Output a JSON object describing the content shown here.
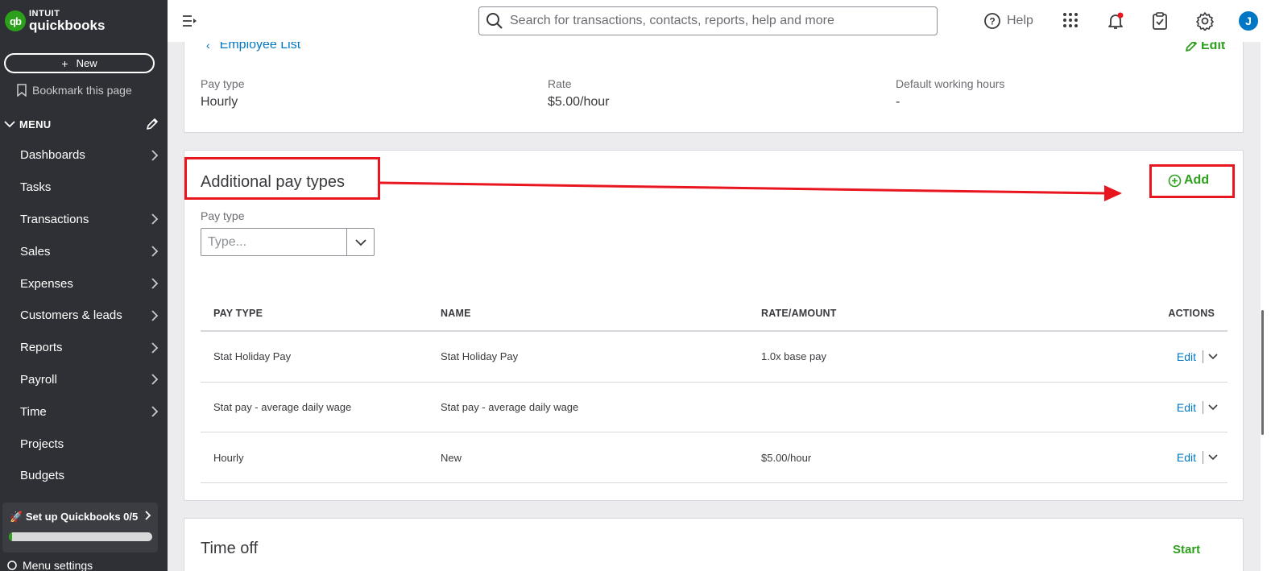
{
  "brand": {
    "line1": "INTUIT",
    "line2": "quickbooks",
    "mark": "qb"
  },
  "sidebar": {
    "new_label": "New",
    "bookmark_label": "Bookmark this page",
    "menu_label": "MENU",
    "items": [
      {
        "label": "Dashboards",
        "has_arrow": true
      },
      {
        "label": "Tasks",
        "has_arrow": false
      },
      {
        "label": "Transactions",
        "has_arrow": true
      },
      {
        "label": "Sales",
        "has_arrow": true
      },
      {
        "label": "Expenses",
        "has_arrow": true
      },
      {
        "label": "Customers & leads",
        "has_arrow": true
      },
      {
        "label": "Reports",
        "has_arrow": true
      },
      {
        "label": "Payroll",
        "has_arrow": true
      },
      {
        "label": "Time",
        "has_arrow": true
      },
      {
        "label": "Projects",
        "has_arrow": false
      },
      {
        "label": "Budgets",
        "has_arrow": false
      }
    ],
    "setup": {
      "label": "Set up Quickbooks 0/5",
      "progress": 0.02
    },
    "menu_settings_label": "Menu settings"
  },
  "topbar": {
    "search_placeholder": "Search for transactions, contacts, reports, help and more",
    "help_label": "Help",
    "avatar_initial": "J"
  },
  "employee": {
    "back_label": "Employee List",
    "edit_label": "Edit",
    "fields": [
      {
        "label": "Pay type",
        "value": "Hourly"
      },
      {
        "label": "Rate",
        "value": "$5.00/hour"
      },
      {
        "label": "Default working hours",
        "value": "-"
      }
    ]
  },
  "additional_pay": {
    "title": "Additional pay types",
    "add_label": "Add",
    "filter_label": "Pay type",
    "filter_placeholder": "Type...",
    "columns": [
      "PAY TYPE",
      "NAME",
      "RATE/AMOUNT",
      "ACTIONS"
    ],
    "rows": [
      {
        "pay_type": "Stat Holiday Pay",
        "name": "Stat Holiday Pay",
        "rate": "1.0x base pay",
        "action": "Edit"
      },
      {
        "pay_type": "Stat pay - average daily wage",
        "name": "Stat pay - average daily wage",
        "rate": "",
        "action": "Edit"
      },
      {
        "pay_type": "Hourly",
        "name": "New",
        "rate": "$5.00/hour",
        "action": "Edit"
      }
    ]
  },
  "time_off": {
    "title": "Time off",
    "start_label": "Start"
  },
  "colors": {
    "brand_green": "#2ca01c",
    "link_blue": "#0077c5",
    "annotation_red": "#e8161e",
    "sidebar_bg": "#2f3035"
  }
}
